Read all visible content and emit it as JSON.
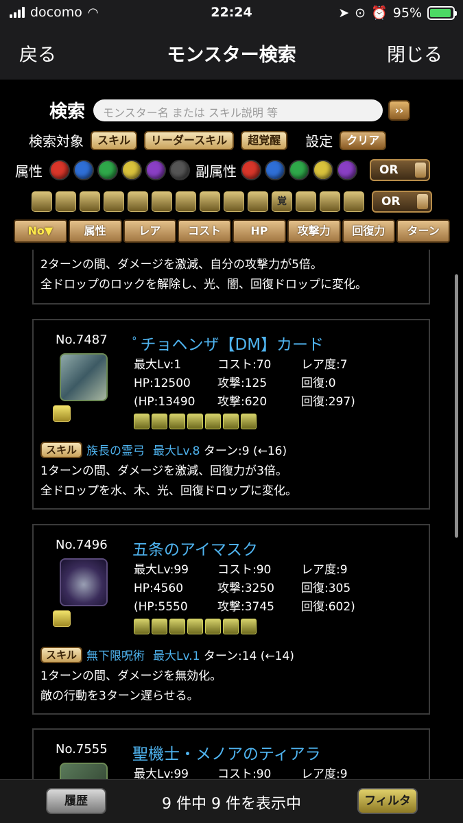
{
  "status": {
    "carrier": "docomo",
    "time": "22:24",
    "battery": "95%"
  },
  "nav": {
    "back": "戻る",
    "title": "モンスター検索",
    "close": "閉じる"
  },
  "search": {
    "label": "検索",
    "placeholder": "モンスター名 または スキル説明 等",
    "go": "››",
    "target_label": "検索対象",
    "targets": [
      "スキル",
      "リーダースキル",
      "超覚醒"
    ],
    "settings_label": "設定",
    "clear": "クリア",
    "attr_label": "属性",
    "sub_attr_label": "副属性",
    "attr_mode": "OR",
    "awaken_mode": "OR",
    "awaken_mark": "覚"
  },
  "orb_colors": {
    "fire": "#d8362a",
    "water": "#2f6fd6",
    "wood": "#2fa84a",
    "light": "#d9c23c",
    "dark": "#8a3fc4",
    "none": "#555555"
  },
  "sort": [
    "No▼",
    "属性",
    "レア",
    "コスト",
    "HP",
    "攻撃力",
    "回復力",
    "ターン"
  ],
  "partial_card": {
    "desc": [
      "2ターンの間、ダメージを激減、自分の攻撃力が5倍。",
      "全ドロップのロックを解除し、光、闇、回復ドロップに変化。"
    ]
  },
  "cards": [
    {
      "no": "No.7487",
      "name": "ﾟチョヘンザ【DM】カード",
      "stats": [
        [
          "最大Lv:1",
          "コスト:70",
          "レア度:7"
        ],
        [
          "HP:12500",
          "攻撃:125",
          "回復:0"
        ],
        [
          "(HP:13490",
          "攻撃:620",
          "回復:297)"
        ]
      ],
      "skill_tag": "スキル",
      "skill_name": "族長の霊弓",
      "skill_lv": "最大Lv.8",
      "skill_turn": "ターン:9 (←16)",
      "desc": [
        "1ターンの間、ダメージを激減、回復力が3倍。",
        "全ドロップを水、木、光、回復ドロップに変化。"
      ]
    },
    {
      "no": "No.7496",
      "name": "五条のアイマスク",
      "stats": [
        [
          "最大Lv:99",
          "コスト:90",
          "レア度:9"
        ],
        [
          "HP:4560",
          "攻撃:3250",
          "回復:305"
        ],
        [
          "(HP:5550",
          "攻撃:3745",
          "回復:602)"
        ]
      ],
      "skill_tag": "スキル",
      "skill_name": "無下限呪術",
      "skill_lv": "最大Lv.1",
      "skill_turn": "ターン:14 (←14)",
      "desc": [
        "1ターンの間、ダメージを無効化。",
        "敵の行動を3ターン遅らせる。"
      ]
    },
    {
      "no": "No.7555",
      "name": "聖機士・メノアのティアラ",
      "stats": [
        [
          "最大Lv:99",
          "コスト:90",
          "レア度:9"
        ]
      ]
    }
  ],
  "bottom": {
    "history": "履歴",
    "count": "9 件中 9 件を表示中",
    "filter": "フィルタ"
  }
}
